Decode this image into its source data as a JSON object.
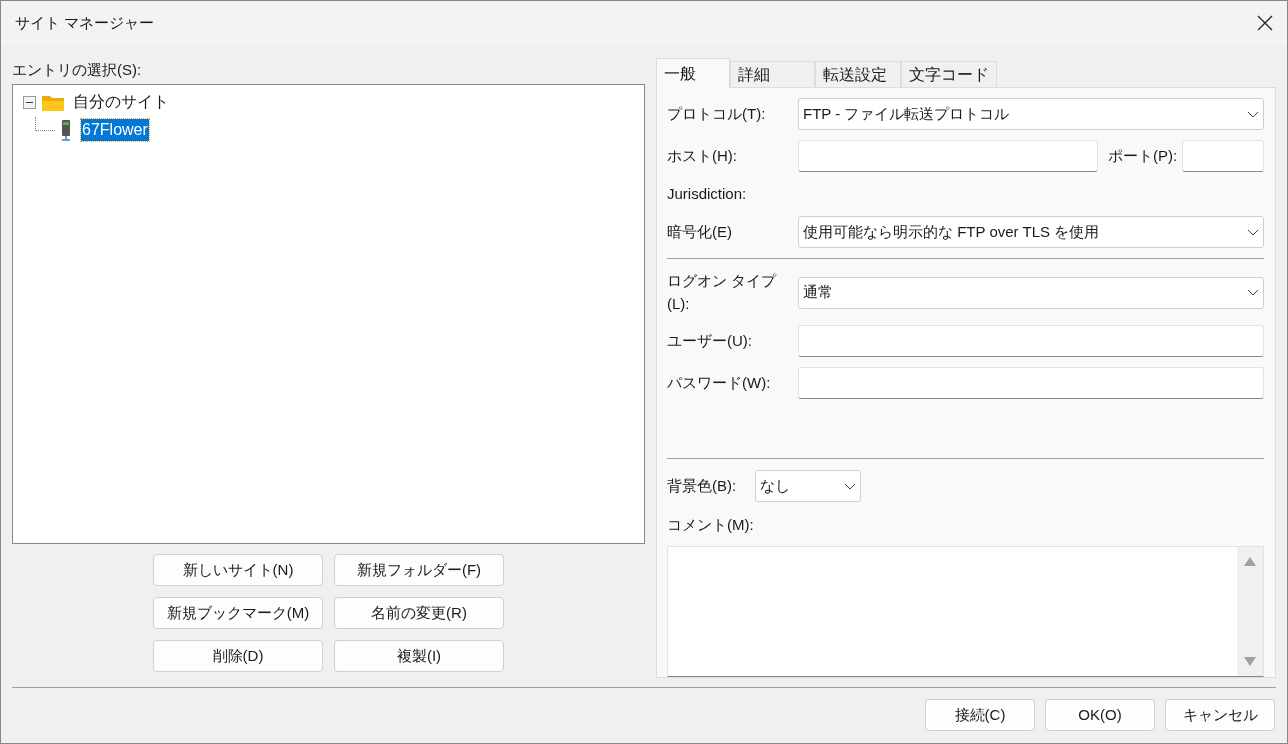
{
  "window": {
    "title": "サイト マネージャー"
  },
  "entries": {
    "label": "エントリの選択(S):",
    "tree": [
      {
        "label": "自分のサイト",
        "kind": "folder",
        "expanded": true,
        "selected": false,
        "children": [
          {
            "label": "67Flower",
            "kind": "site",
            "selected": true
          }
        ]
      }
    ]
  },
  "entry_buttons": [
    "新しいサイト(N)",
    "新規フォルダー(F)",
    "新規ブックマーク(M)",
    "名前の変更(R)",
    "削除(D)",
    "複製(I)"
  ],
  "tabs": [
    {
      "label": "一般",
      "selected": true
    },
    {
      "label": "詳細",
      "selected": false
    },
    {
      "label": "転送設定",
      "selected": false
    },
    {
      "label": "文字コード",
      "selected": false
    }
  ],
  "connection": [
    {
      "kind": "select",
      "label": "プロトコル(T):",
      "value": "FTP - ファイル転送プロトコル"
    },
    {
      "kind": "host",
      "label": "ホスト(H):",
      "port_label": "ポート(P):"
    },
    {
      "kind": "label",
      "label": "Jurisdiction:"
    },
    {
      "kind": "select",
      "label": "暗号化(E)",
      "value": "使用可能なら明示的な FTP over TLS を使用"
    }
  ],
  "logon": [
    {
      "kind": "select",
      "label": "ログオン タイプ(L):",
      "value": "通常"
    },
    {
      "kind": "text",
      "label": "ユーザー(U):"
    },
    {
      "kind": "text",
      "label": "パスワード(W):"
    }
  ],
  "background": {
    "label": "背景色(B):",
    "value": "なし"
  },
  "comment": {
    "label": "コメント(M):"
  },
  "dialog_buttons": [
    "接続(C)",
    "OK(O)",
    "キャンセル"
  ]
}
